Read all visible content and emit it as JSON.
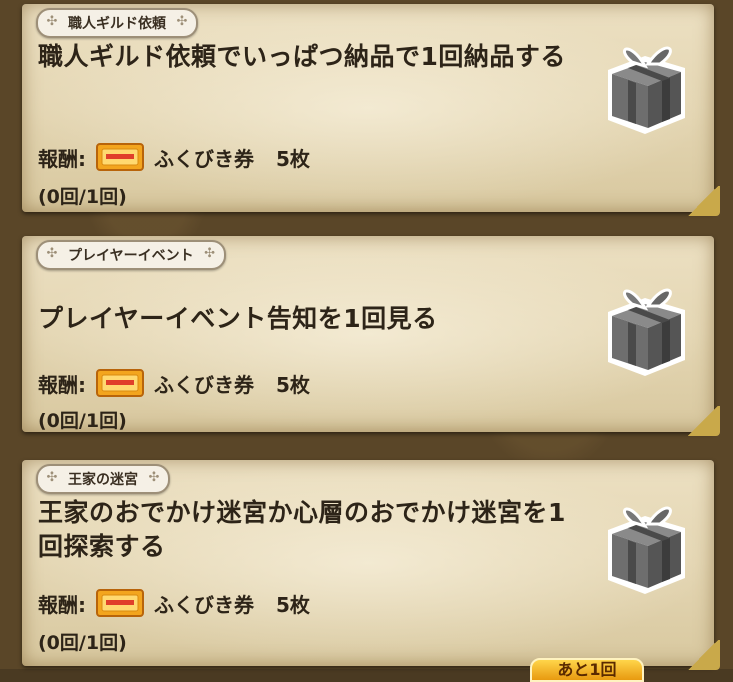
{
  "quests": [
    {
      "category": "職人ギルド依頼",
      "title": "職人ギルド依頼でいっぱつ納品で1回納品する",
      "reward_label": "報酬:",
      "reward_item": "ふくびき券",
      "reward_qty": "5枚",
      "progress": "(0回/1回)"
    },
    {
      "category": "プレイヤーイベント",
      "title": "プレイヤーイベント告知を1回見る",
      "reward_label": "報酬:",
      "reward_item": "ふくびき券",
      "reward_qty": "5枚",
      "progress": "(0回/1回)"
    },
    {
      "category": "王家の迷宮",
      "title": "王家のおでかけ迷宮か心層のおでかけ迷宮を1回探索する",
      "reward_label": "報酬:",
      "reward_item": "ふくびき券",
      "reward_qty": "5枚",
      "progress": "(0回/1回)"
    }
  ],
  "footer_badge": "あと1回",
  "icons": {
    "ticket": "ticket-icon",
    "gift": "gift-box-icon",
    "tag_ornament": "cross-ornament-icon"
  },
  "colors": {
    "parchment": "#e4d6b3",
    "text": "#2d2418",
    "ticket": "#f0a020",
    "gift": "#6a6a6a"
  }
}
